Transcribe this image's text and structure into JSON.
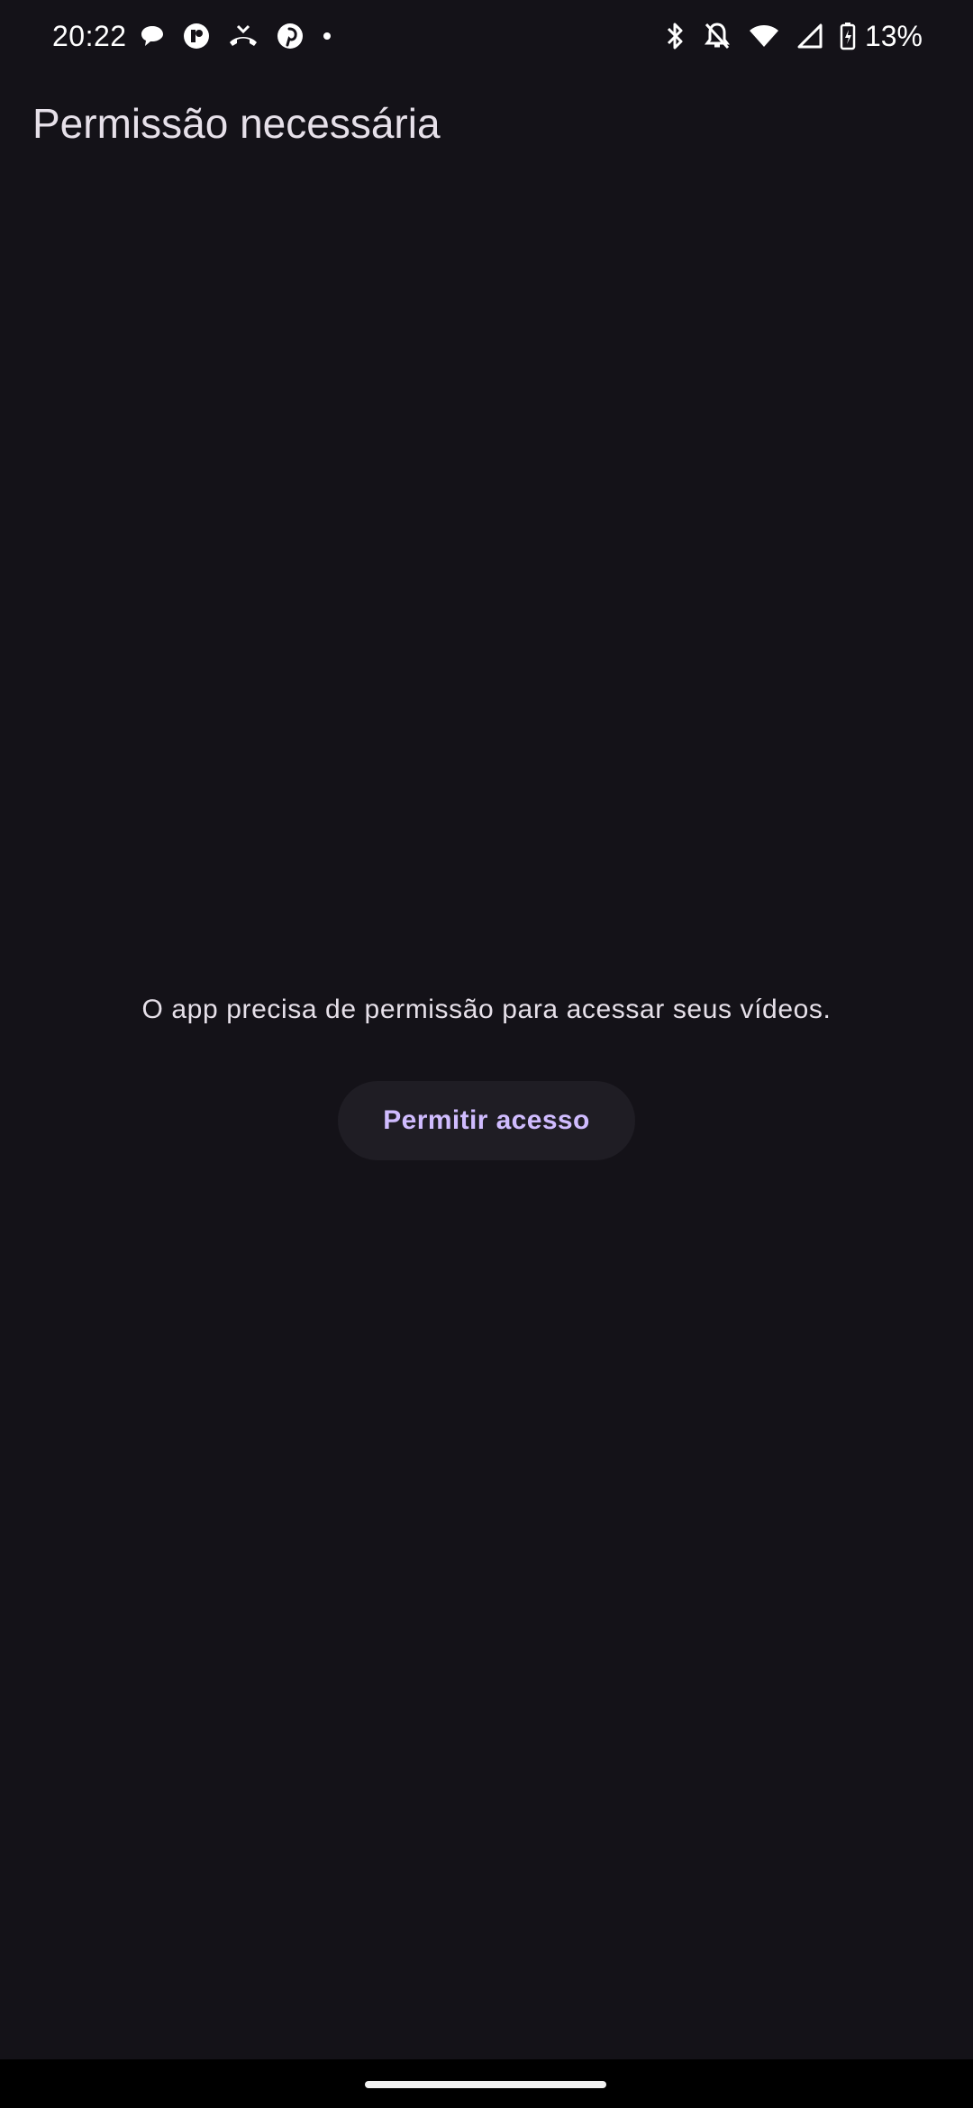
{
  "status_bar": {
    "time": "20:22",
    "left_icons": [
      "chat-bubble-icon",
      "app-badge-icon",
      "missed-call-icon",
      "pinterest-icon",
      "dot-icon"
    ],
    "right_icons": [
      "bluetooth-icon",
      "notifications-off-icon",
      "wifi-icon",
      "cell-signal-icon",
      "battery-charging-icon"
    ],
    "battery_level": "13%"
  },
  "app_bar": {
    "title": "Permissão necessária"
  },
  "main": {
    "message": "O app precisa de permissão para acessar seus vídeos.",
    "allow_button_label": "Permitir acesso"
  },
  "colors": {
    "background": "#141218",
    "button_background": "#1f1d24",
    "button_text": "#d0bcff",
    "primary_text": "#e6e0e9"
  }
}
